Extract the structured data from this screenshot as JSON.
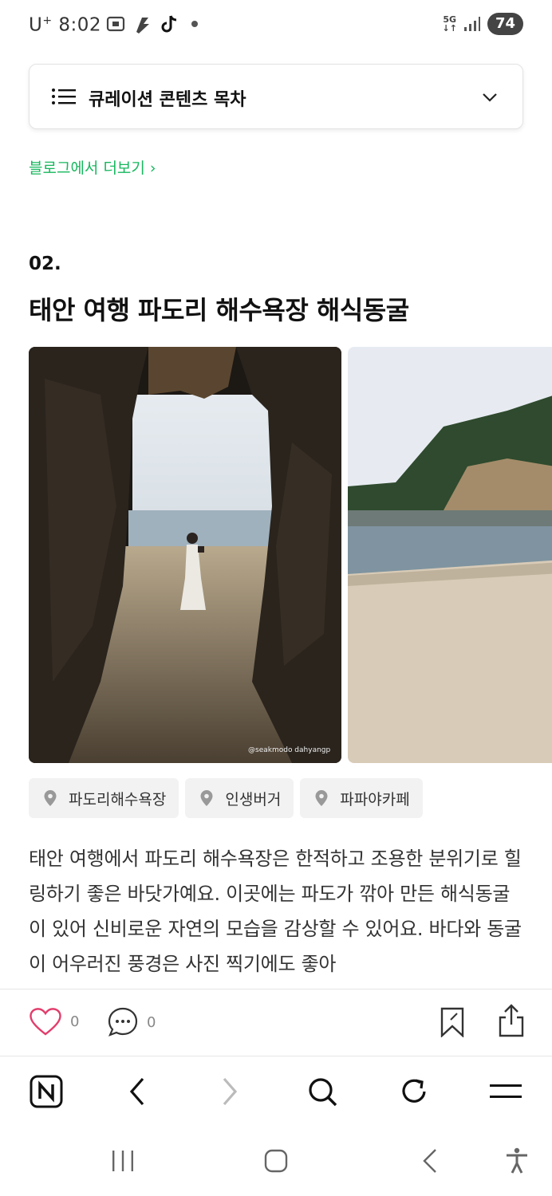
{
  "status_bar": {
    "carrier": "U",
    "carrier_sup": "+",
    "time": "8:02",
    "network": "5G",
    "battery": "74"
  },
  "toc": {
    "label": "큐레이션 콘텐츠 목차"
  },
  "blog_more": "블로그에서 더보기 ›",
  "section": {
    "number": "02.",
    "title": "태안 여행 파도리 해수욕장 해식동굴"
  },
  "photos": {
    "credit": "@seakmodo dahyangp"
  },
  "tags": [
    {
      "label": "파도리해수욕장"
    },
    {
      "label": "인생버거"
    },
    {
      "label": "파파야카페"
    }
  ],
  "description": "태안 여행에서 파도리 해수욕장은 한적하고 조용한 분위기로 힐링하기 좋은 바닷가예요. 이곳에는 파도가 깎아 만든 해식동굴이 있어 신비로운 자연의 모습을 감상할 수 있어요. 바다와 동굴이 어우러진 풍경은 사진 찍기에도 좋아",
  "actions": {
    "like_count": "0",
    "comment_count": "0"
  },
  "icons": {
    "toc": "list-icon",
    "expand": "chevron-down-icon",
    "tag": "location-pin-icon",
    "like": "heart-icon",
    "comment": "comment-icon",
    "bookmark": "bookmark-icon",
    "share": "share-icon",
    "browser": [
      "naver-home-icon",
      "back-icon",
      "forward-icon",
      "search-icon",
      "refresh-icon",
      "menu-icon"
    ],
    "system": [
      "recents-icon",
      "home-icon",
      "system-back-icon",
      "accessibility-icon"
    ]
  },
  "colors": {
    "accent_green": "#17b75e",
    "like_pink": "#e23d6b"
  }
}
